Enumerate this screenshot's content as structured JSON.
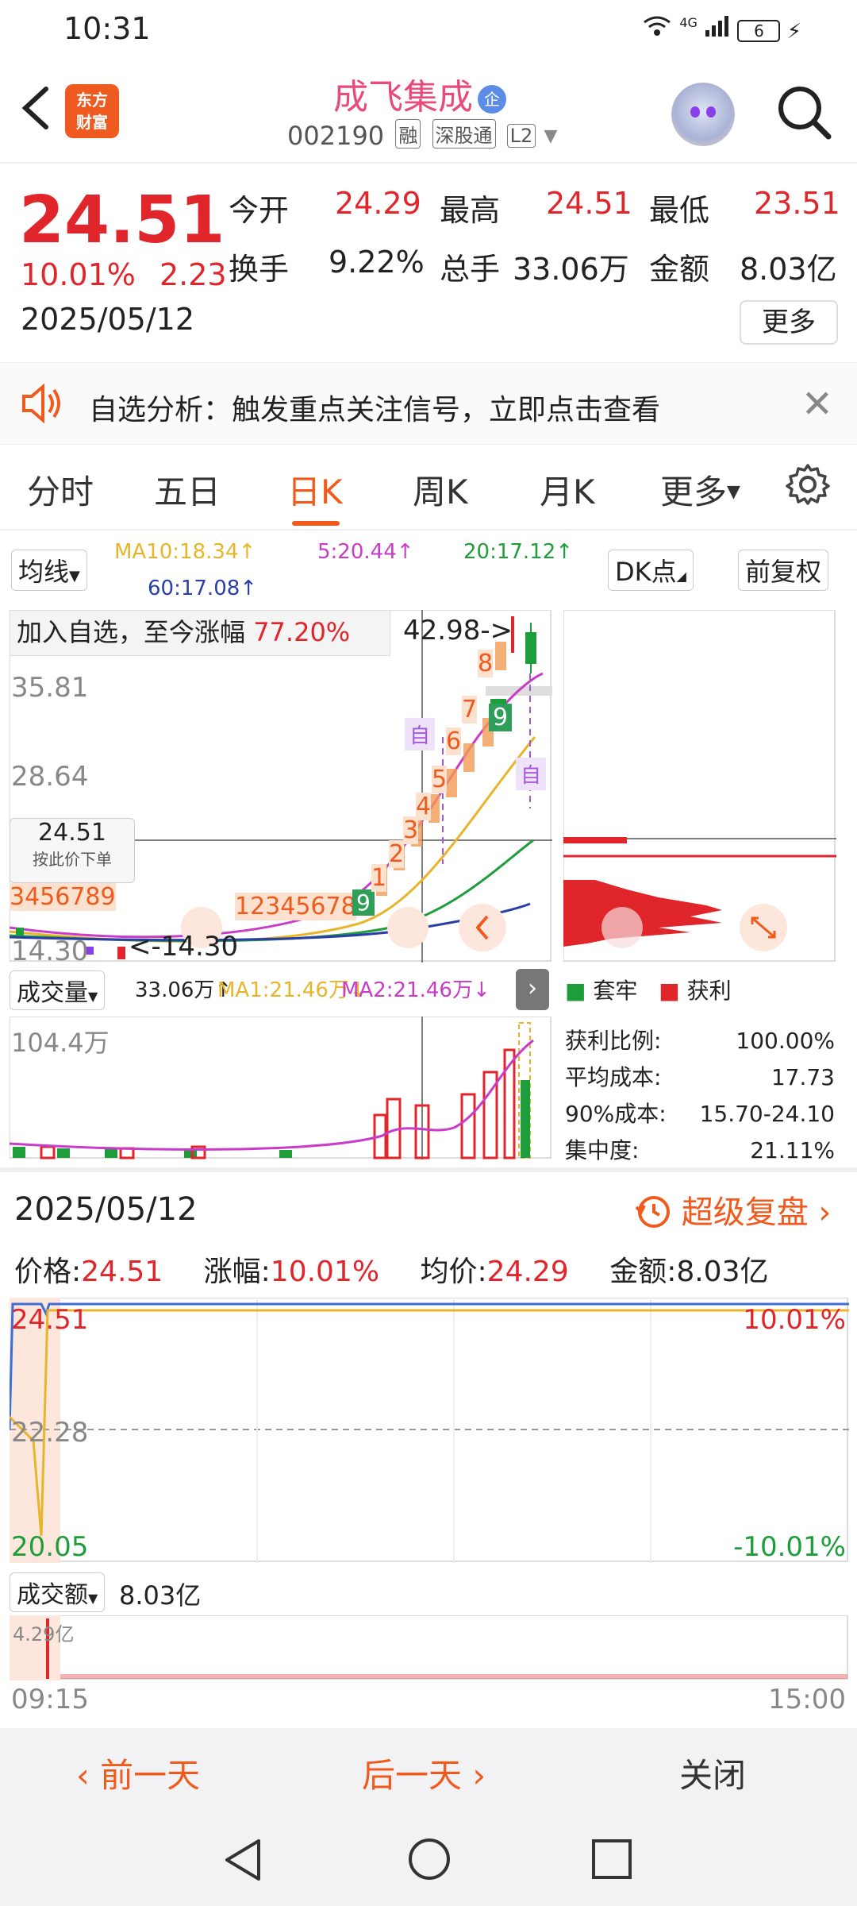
{
  "status_bar": {
    "time": "10:31",
    "network": "4G",
    "battery": "6"
  },
  "header": {
    "logo_text_1": "东方",
    "logo_text_2": "财富",
    "stock_name": "成飞集成",
    "stock_badge": "企",
    "stock_code": "002190",
    "tags": [
      "融",
      "深股通",
      "L2"
    ]
  },
  "quote": {
    "price": "24.51",
    "change_pct": "10.01%",
    "change_amt": "2.23",
    "date": "2025/05/12",
    "open_label": "今开",
    "open": "24.29",
    "high_label": "最高",
    "high": "24.51",
    "low_label": "最低",
    "low": "23.51",
    "turnover_label": "换手",
    "turnover": "9.22%",
    "volume_label": "总手",
    "volume": "33.06万",
    "amount_label": "金额",
    "amount": "8.03亿",
    "more": "更多"
  },
  "banner": {
    "text": "自选分析：触发重点关注信号，立即点击查看"
  },
  "tabs": [
    "分时",
    "五日",
    "日K",
    "周K",
    "月K",
    "更多"
  ],
  "kline": {
    "ma_selector": "均线",
    "ma10": "MA10:18.34↑",
    "ma5": "5:20.44↑",
    "ma20": "20:17.12↑",
    "ma60": "60:17.08↑",
    "dk_button": "DK点",
    "adjust_button": "前复权",
    "add_note": "加入自选，至今涨幅",
    "add_pct": "77.20%",
    "y_labels": [
      "35.81",
      "28.64",
      "14.30"
    ],
    "high_marker": "42.98",
    "low_marker": "14.30",
    "crosshair_price": "24.51",
    "crosshair_hint": "按此价下单",
    "self_marks": [
      "自",
      "自"
    ],
    "seq_left": "3456789",
    "seq_mid": "12345678",
    "seq_mid_end": "9",
    "seq_right": [
      "1",
      "2",
      "3",
      "4",
      "5",
      "6",
      "7",
      "8"
    ],
    "seq_right_end": "9",
    "volume_selector": "成交量",
    "volume_value": "33.06万↑",
    "vol_ma1": "MA1:21.46万↓",
    "vol_ma2": "MA2:21.46万↓",
    "vol_max": "104.4万",
    "chip_legend_trapped": "套牢",
    "chip_legend_profit": "获利",
    "chip_stats": [
      {
        "label": "获利比例:",
        "value": "100.00%"
      },
      {
        "label": "平均成本:",
        "value": "17.73"
      },
      {
        "label": "90%成本:",
        "value": "15.70-24.10"
      },
      {
        "label": "集中度:",
        "value": "21.11%"
      }
    ]
  },
  "intraday": {
    "date": "2025/05/12",
    "replay": "超级复盘",
    "price_label": "价格:",
    "price": "24.51",
    "chg_label": "涨幅:",
    "chg": "10.01%",
    "avg_label": "均价:",
    "avg": "24.29",
    "amt_label": "金额:",
    "amt": "8.03亿",
    "y_top": "24.51",
    "y_mid": "22.28",
    "y_bot": "20.05",
    "pct_top": "10.01%",
    "pct_bot": "-10.01%",
    "amount_selector": "成交额",
    "amount_value": "8.03亿",
    "amount_max": "4.29亿",
    "t_start": "09:15",
    "t_end": "15:00"
  },
  "bottom_nav": {
    "prev": "前一天",
    "next": "后一天",
    "close": "关闭"
  }
}
